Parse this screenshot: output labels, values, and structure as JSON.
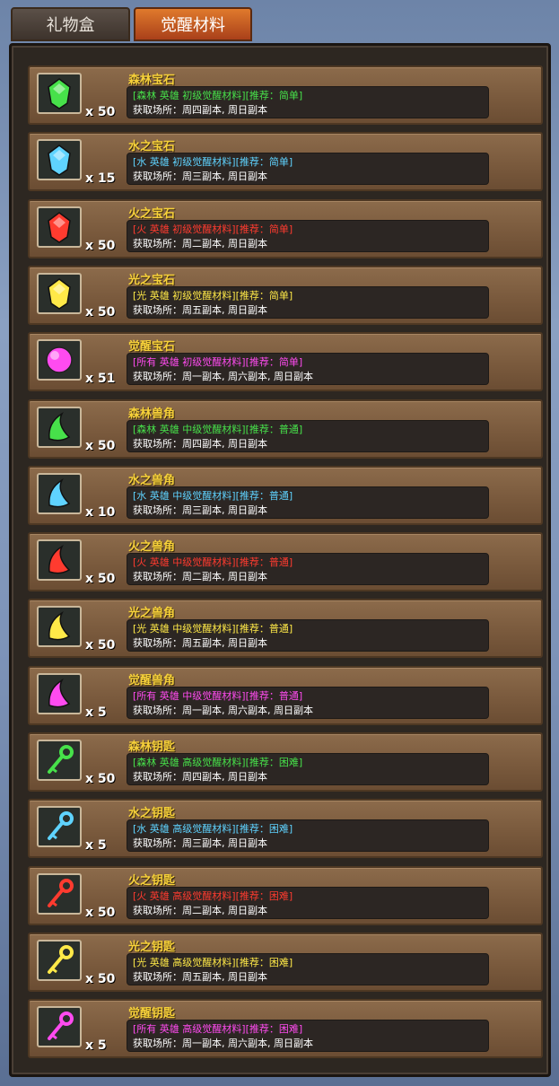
{
  "tabs": [
    {
      "label": "礼物盒",
      "active": false
    },
    {
      "label": "觉醒材料",
      "active": true
    }
  ],
  "colors": {
    "forest": "#47e14a",
    "water": "#5fd3ff",
    "fire": "#ff3b2f",
    "light": "#ffe948",
    "awaken": "#ff4bf0"
  },
  "items": [
    {
      "name": "森林宝石",
      "count": "x 50",
      "tag": "[森林 英雄 初级觉醒材料][推荐：简单]",
      "source": "获取场所：周四副本, 周日副本",
      "element": "forest",
      "icon": "gem-icon"
    },
    {
      "name": "水之宝石",
      "count": "x 15",
      "tag": "[水 英雄 初级觉醒材料][推荐：简单]",
      "source": "获取场所：周三副本, 周日副本",
      "element": "water",
      "icon": "gem-icon"
    },
    {
      "name": "火之宝石",
      "count": "x 50",
      "tag": "[火 英雄 初级觉醒材料][推荐：简单]",
      "source": "获取场所：周二副本, 周日副本",
      "element": "fire",
      "icon": "gem-icon"
    },
    {
      "name": "光之宝石",
      "count": "x 50",
      "tag": "[光 英雄 初级觉醒材料][推荐：简单]",
      "source": "获取场所：周五副本, 周日副本",
      "element": "light",
      "icon": "gem-icon"
    },
    {
      "name": "觉醒宝石",
      "count": "x 51",
      "tag": "[所有 英雄 初级觉醒材料][推荐：简单]",
      "source": "获取场所：周一副本, 周六副本, 周日副本",
      "element": "awaken",
      "icon": "orb-icon"
    },
    {
      "name": "森林兽角",
      "count": "x 50",
      "tag": "[森林 英雄 中级觉醒材料][推荐：普通]",
      "source": "获取场所：周四副本, 周日副本",
      "element": "forest",
      "icon": "horn-icon"
    },
    {
      "name": "水之兽角",
      "count": "x 10",
      "tag": "[水 英雄 中级觉醒材料][推荐：普通]",
      "source": "获取场所：周三副本, 周日副本",
      "element": "water",
      "icon": "horn-icon"
    },
    {
      "name": "火之兽角",
      "count": "x 50",
      "tag": "[火 英雄 中级觉醒材料][推荐：普通]",
      "source": "获取场所：周二副本, 周日副本",
      "element": "fire",
      "icon": "horn-icon"
    },
    {
      "name": "光之兽角",
      "count": "x 50",
      "tag": "[光 英雄 中级觉醒材料][推荐：普通]",
      "source": "获取场所：周五副本, 周日副本",
      "element": "light",
      "icon": "horn-icon"
    },
    {
      "name": "觉醒兽角",
      "count": "x 5",
      "tag": "[所有 英雄 中级觉醒材料][推荐：普通]",
      "source": "获取场所：周一副本, 周六副本, 周日副本",
      "element": "awaken",
      "icon": "horn-icon"
    },
    {
      "name": "森林钥匙",
      "count": "x 50",
      "tag": "[森林 英雄 高级觉醒材料][推荐：困难]",
      "source": "获取场所：周四副本, 周日副本",
      "element": "forest",
      "icon": "key-icon"
    },
    {
      "name": "水之钥匙",
      "count": "x 5",
      "tag": "[水 英雄 高级觉醒材料][推荐：困难]",
      "source": "获取场所：周三副本, 周日副本",
      "element": "water",
      "icon": "key-icon"
    },
    {
      "name": "火之钥匙",
      "count": "x 50",
      "tag": "[火 英雄 高级觉醒材料][推荐：困难]",
      "source": "获取场所：周二副本, 周日副本",
      "element": "fire",
      "icon": "key-icon"
    },
    {
      "name": "光之钥匙",
      "count": "x 50",
      "tag": "[光 英雄 高级觉醒材料][推荐：困难]",
      "source": "获取场所：周五副本, 周日副本",
      "element": "light",
      "icon": "key-icon"
    },
    {
      "name": "觉醒钥匙",
      "count": "x 5",
      "tag": "[所有 英雄 高级觉醒材料][推荐：困难]",
      "source": "获取场所：周一副本, 周六副本, 周日副本",
      "element": "awaken",
      "icon": "key-icon"
    }
  ]
}
